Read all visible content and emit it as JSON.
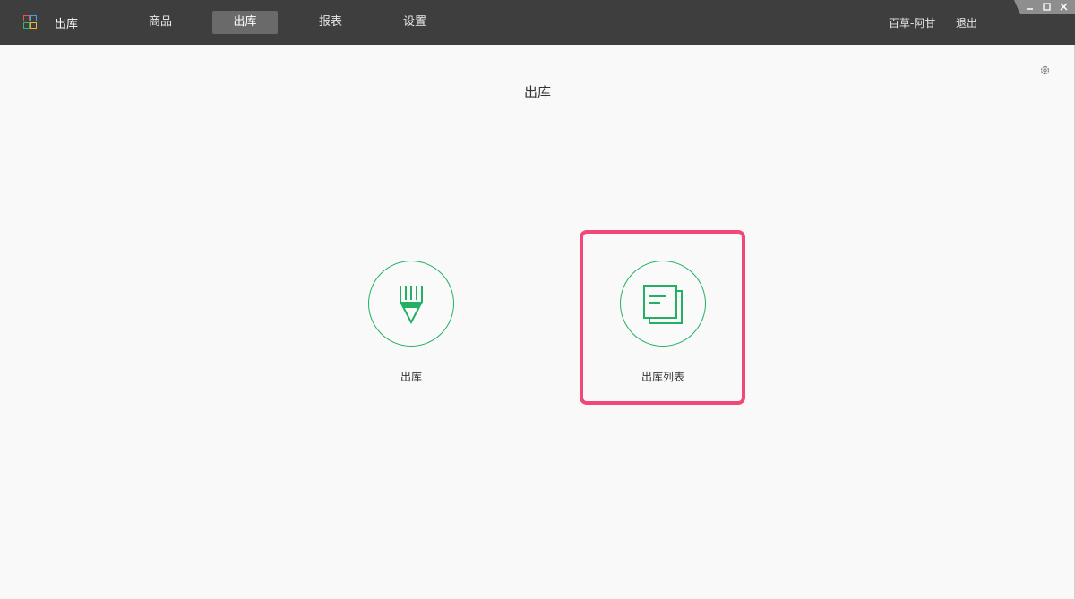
{
  "app": {
    "title": "出库",
    "logo_icon": "app-grid-logo"
  },
  "nav": {
    "items": [
      {
        "label": "商品",
        "active": false
      },
      {
        "label": "出库",
        "active": true
      },
      {
        "label": "报表",
        "active": false
      },
      {
        "label": "设置",
        "active": false
      }
    ]
  },
  "user": {
    "name": "百草-阿甘",
    "logout_label": "退出"
  },
  "window_controls": [
    "minimize-icon",
    "maximize-icon",
    "close-icon"
  ],
  "page": {
    "title": "出库",
    "settings_icon": "gear-icon"
  },
  "tiles": [
    {
      "label": "出库",
      "icon": "pencil-icon"
    },
    {
      "label": "出库列表",
      "icon": "documents-icon",
      "highlighted": true
    }
  ],
  "colors": {
    "topbar": "#3e3e3e",
    "accent_green": "#22b063",
    "highlight": "#f24877",
    "active_tab": "#6a6a6a"
  }
}
